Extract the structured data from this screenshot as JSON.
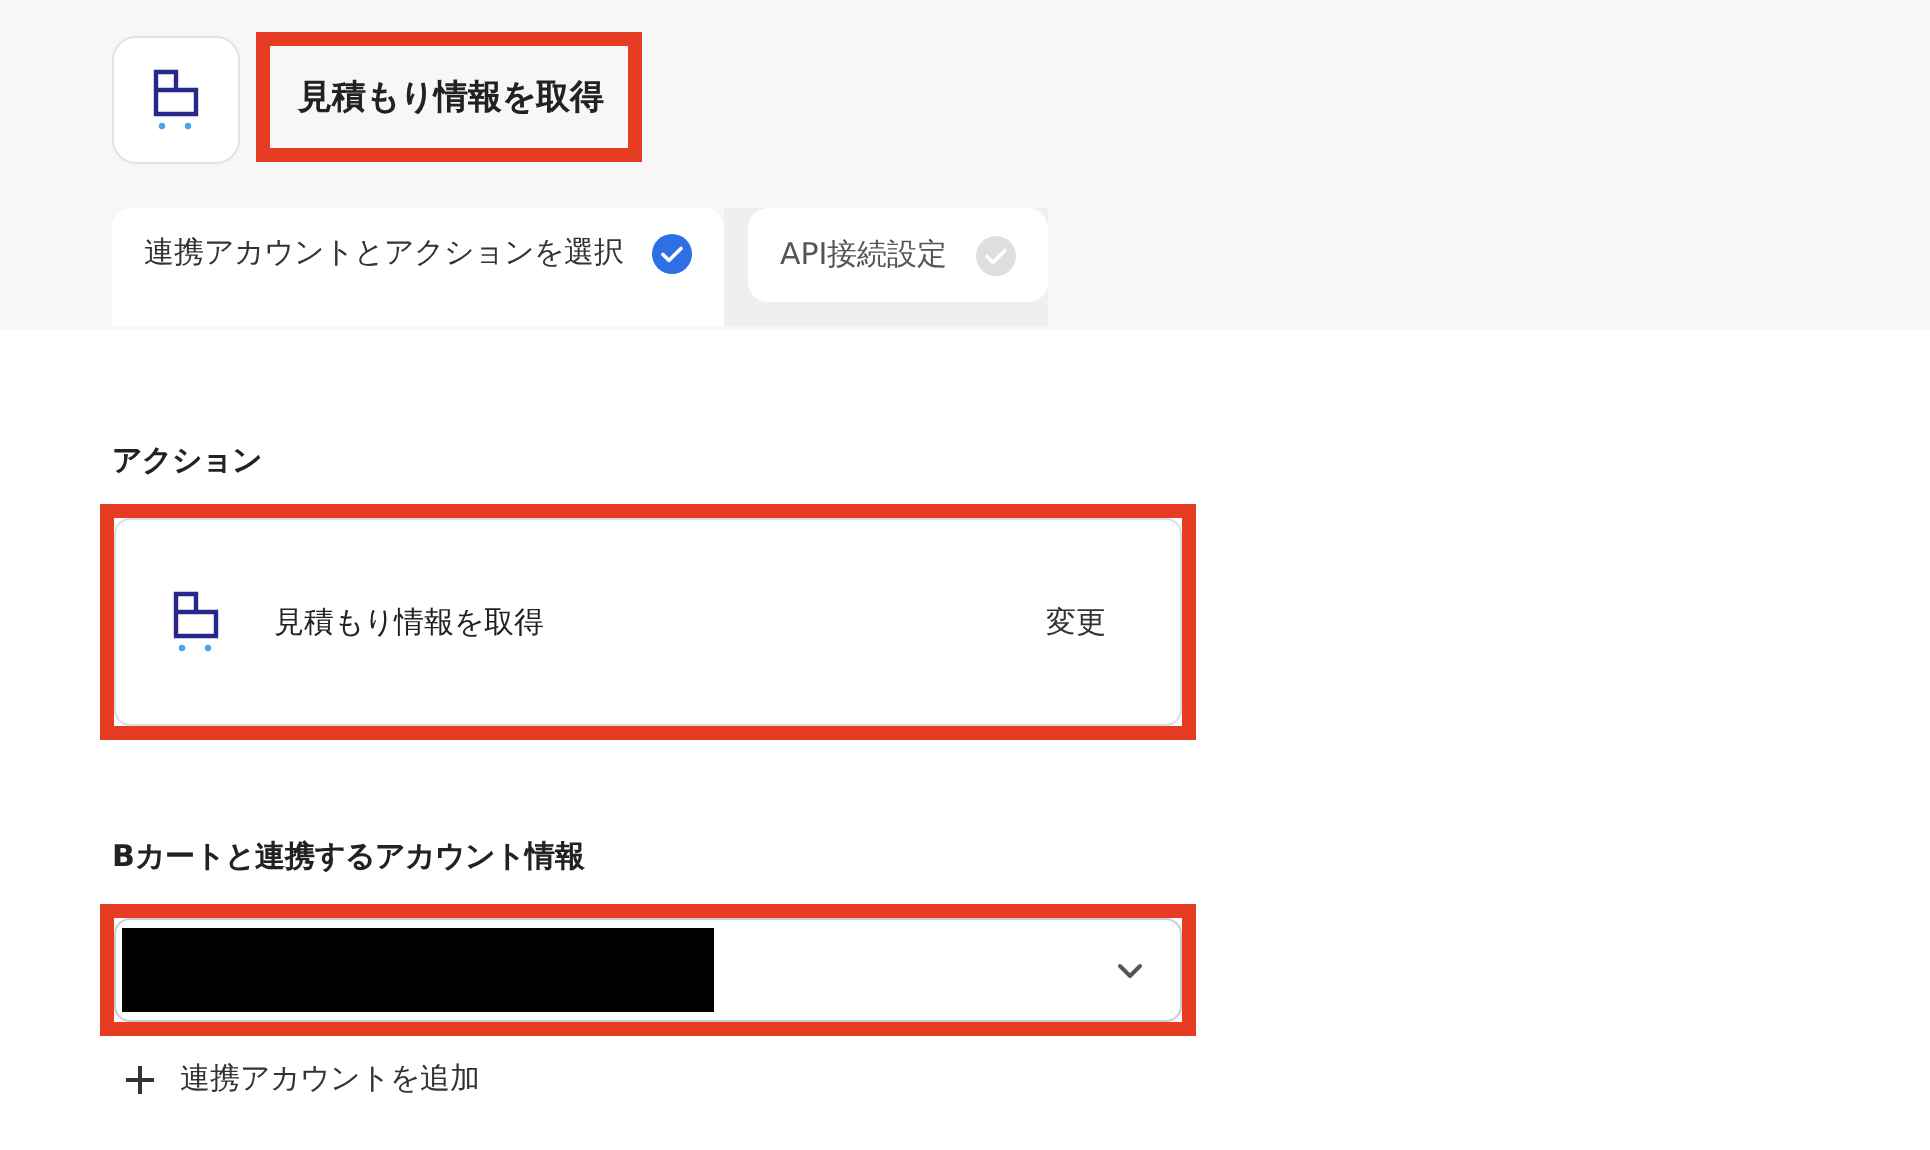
{
  "header": {
    "title": "見積もり情報を取得",
    "highlighted": true
  },
  "steps": [
    {
      "label": "連携アカウントとアクションを選択",
      "selected": true,
      "completed": true
    },
    {
      "label": "API接続設定",
      "selected": false,
      "completed": false
    }
  ],
  "action": {
    "label": "アクション",
    "name": "見積もり情報を取得",
    "change": "変更",
    "highlighted": true
  },
  "account": {
    "label": "Bカートと連携するアカウント情報",
    "redacted": true,
    "highlighted": true,
    "add": "連携アカウントを追加"
  }
}
